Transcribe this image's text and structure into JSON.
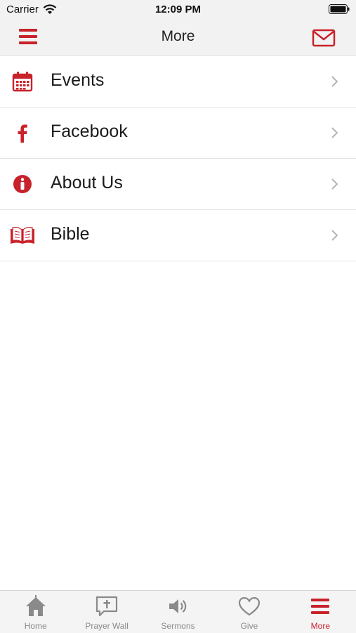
{
  "status_bar": {
    "carrier": "Carrier",
    "time": "12:09 PM"
  },
  "nav": {
    "title": "More"
  },
  "menu": [
    {
      "label": "Events",
      "icon": "calendar-icon"
    },
    {
      "label": "Facebook",
      "icon": "facebook-icon"
    },
    {
      "label": "About Us",
      "icon": "info-icon"
    },
    {
      "label": "Bible",
      "icon": "bible-icon"
    }
  ],
  "tabs": [
    {
      "label": "Home",
      "icon": "home-icon"
    },
    {
      "label": "Prayer Wall",
      "icon": "prayer-icon"
    },
    {
      "label": "Sermons",
      "icon": "speaker-icon"
    },
    {
      "label": "Give",
      "icon": "heart-icon"
    },
    {
      "label": "More",
      "icon": "menu-icon",
      "active": true
    }
  ],
  "colors": {
    "accent": "#c8222b",
    "inactive_tab": "#8a8a8a",
    "bar_bg": "#f2f2f2"
  }
}
